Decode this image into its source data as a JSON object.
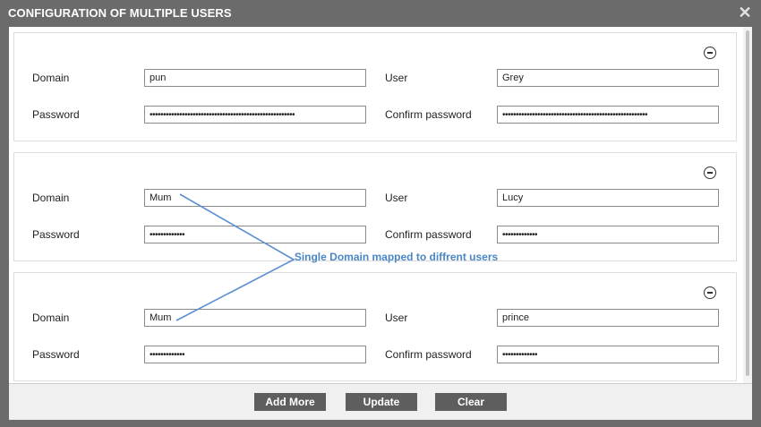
{
  "dialog": {
    "title": "CONFIGURATION OF MULTIPLE USERS",
    "close_icon": "close-icon"
  },
  "labels": {
    "domain": "Domain",
    "user": "User",
    "password": "Password",
    "confirm_password": "Confirm password"
  },
  "users": [
    {
      "domain": "pun",
      "user": "Grey",
      "password": "••••••••••••••••••••••••••••••••••••••••••••••••••••••",
      "confirm_password": "••••••••••••••••••••••••••••••••••••••••••••••••••••••"
    },
    {
      "domain": "Mum",
      "user": "Lucy",
      "password": "•••••••••••••",
      "confirm_password": "•••••••••••••"
    },
    {
      "domain": "Mum",
      "user": "prince",
      "password": "•••••••••••••",
      "confirm_password": "•••••••••••••"
    }
  ],
  "annotation": {
    "text": "Single Domain mapped to diffrent users",
    "color": "#4a86c5"
  },
  "footer": {
    "add_more_label": "Add More",
    "update_label": "Update",
    "clear_label": "Clear"
  }
}
